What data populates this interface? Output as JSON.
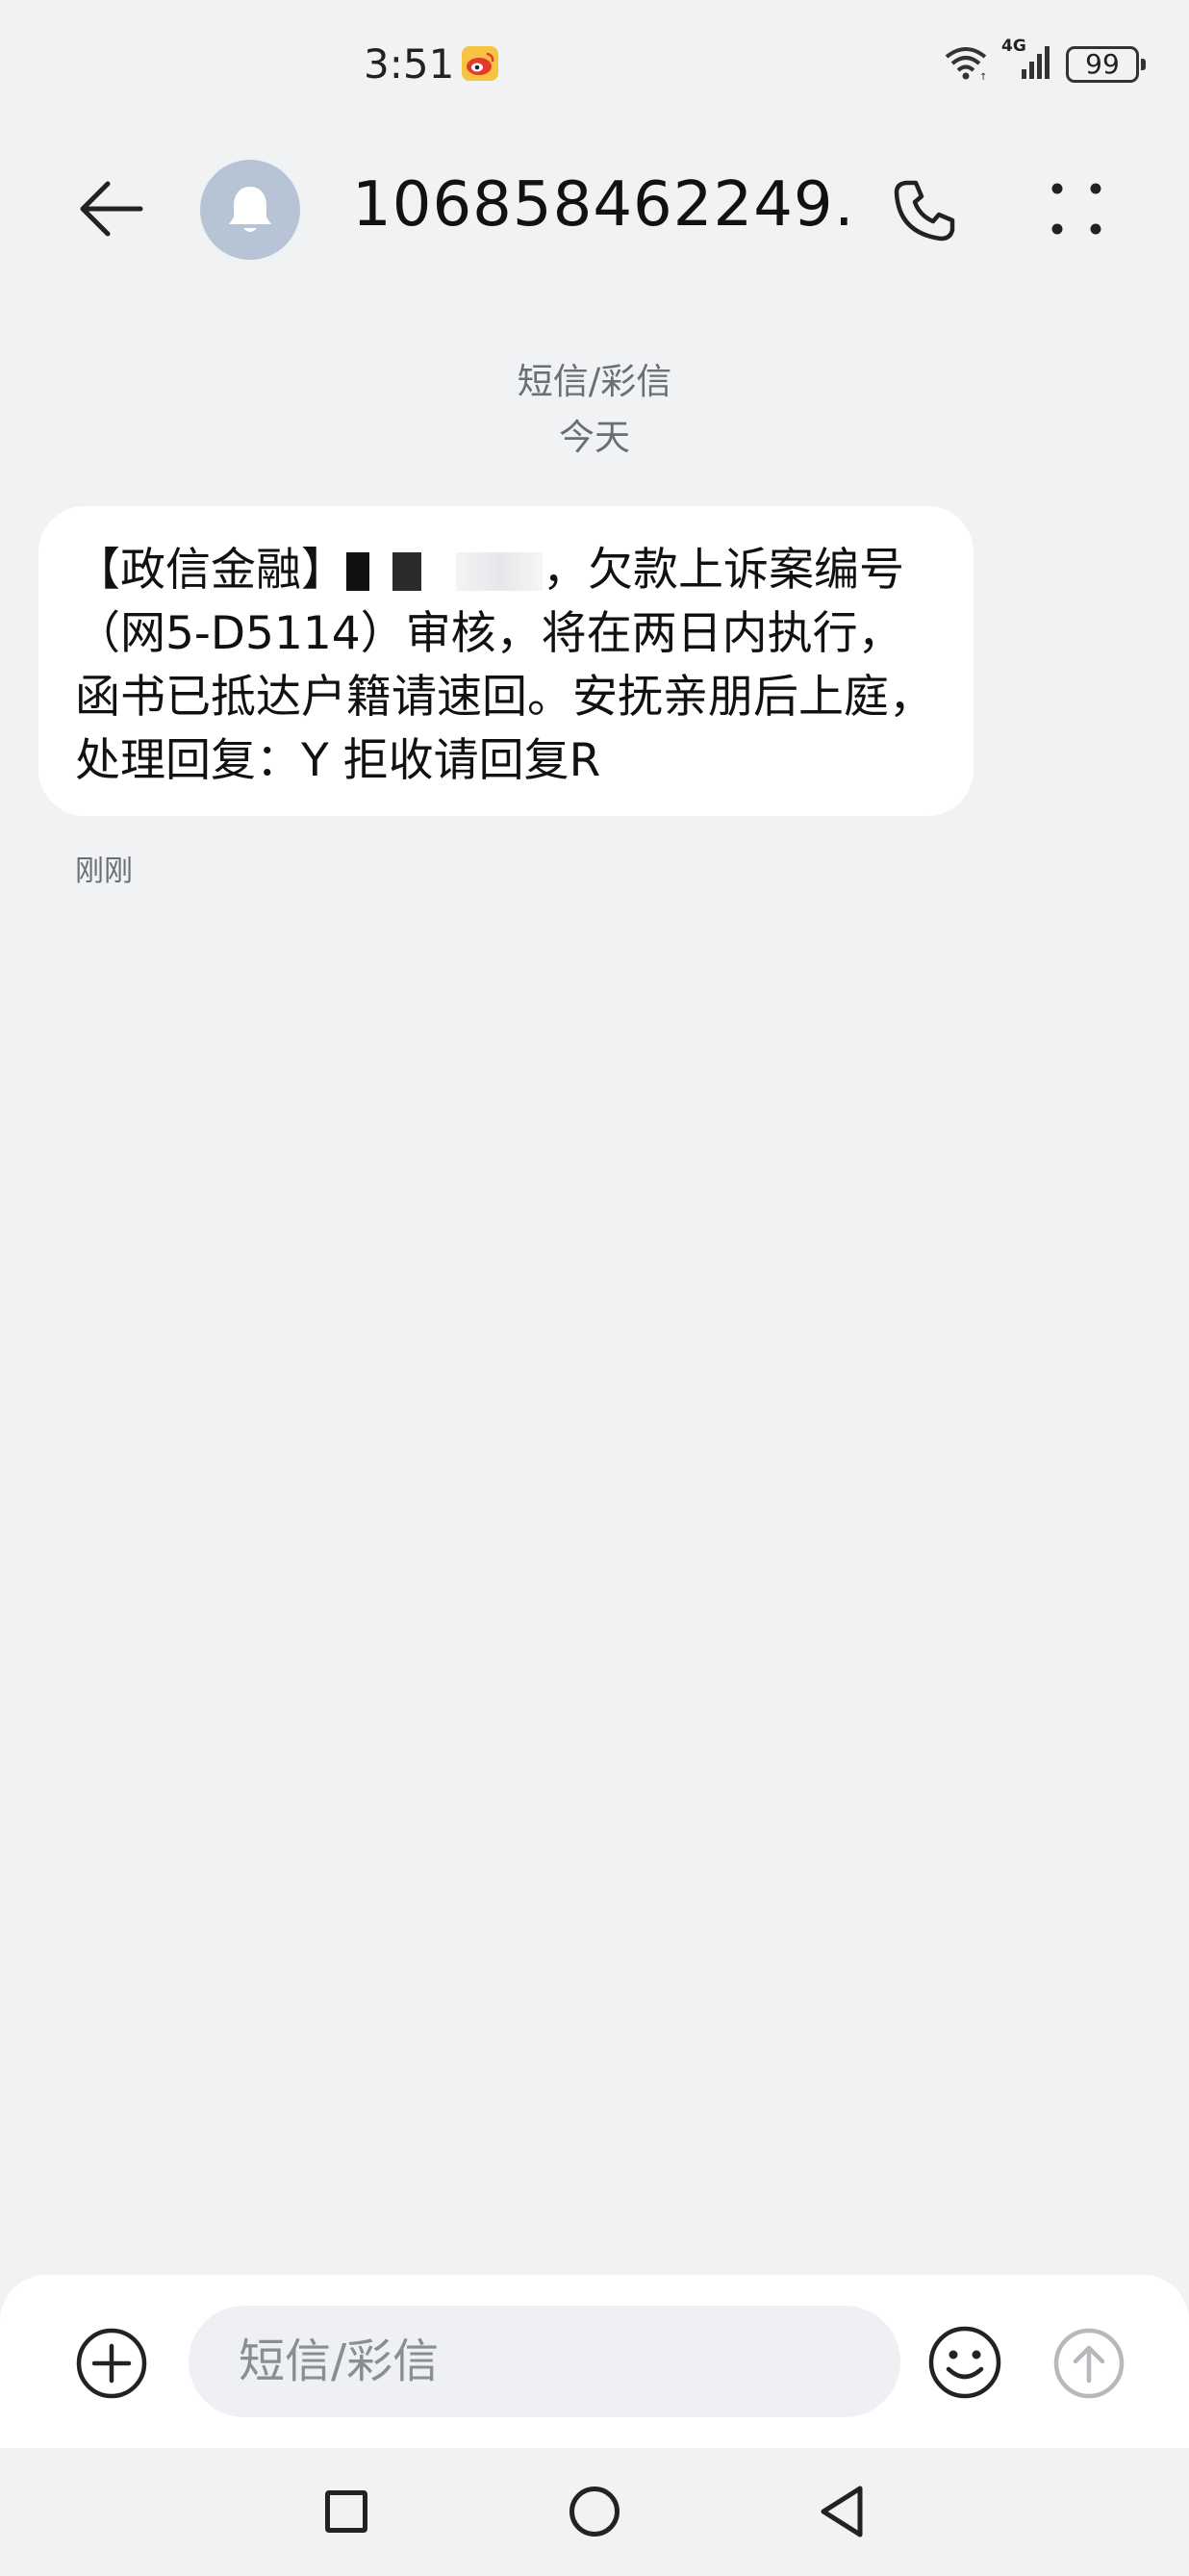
{
  "status_bar": {
    "time": "3:51",
    "network": "4G",
    "battery": "99",
    "icons": [
      "weibo-icon",
      "wifi-icon",
      "cellular-signal-icon",
      "battery-icon"
    ]
  },
  "header": {
    "title": "106858462249…",
    "back_icon": "back-arrow-icon",
    "avatar_icon": "bell-icon",
    "call_icon": "phone-icon",
    "more_icon": "more-dots-icon"
  },
  "conversation": {
    "type_label": "短信/彩信",
    "date_label": "今天",
    "messages": [
      {
        "text_before_redaction": "【政信金融】",
        "text_after_redaction": "，欠款上诉案编号（网5-D5114）审核，将在两日内执行，函书已抵达户籍请速回。安抚亲朋后上庭，处理回复：Y 拒收请回复R",
        "time": "刚刚"
      }
    ]
  },
  "composer": {
    "placeholder": "短信/彩信",
    "add_icon": "add-circle-icon",
    "emoji_icon": "emoji-icon",
    "send_icon": "send-icon"
  },
  "nav_bar": {
    "icons": [
      "recent-apps-icon",
      "home-icon",
      "back-triangle-icon"
    ]
  }
}
